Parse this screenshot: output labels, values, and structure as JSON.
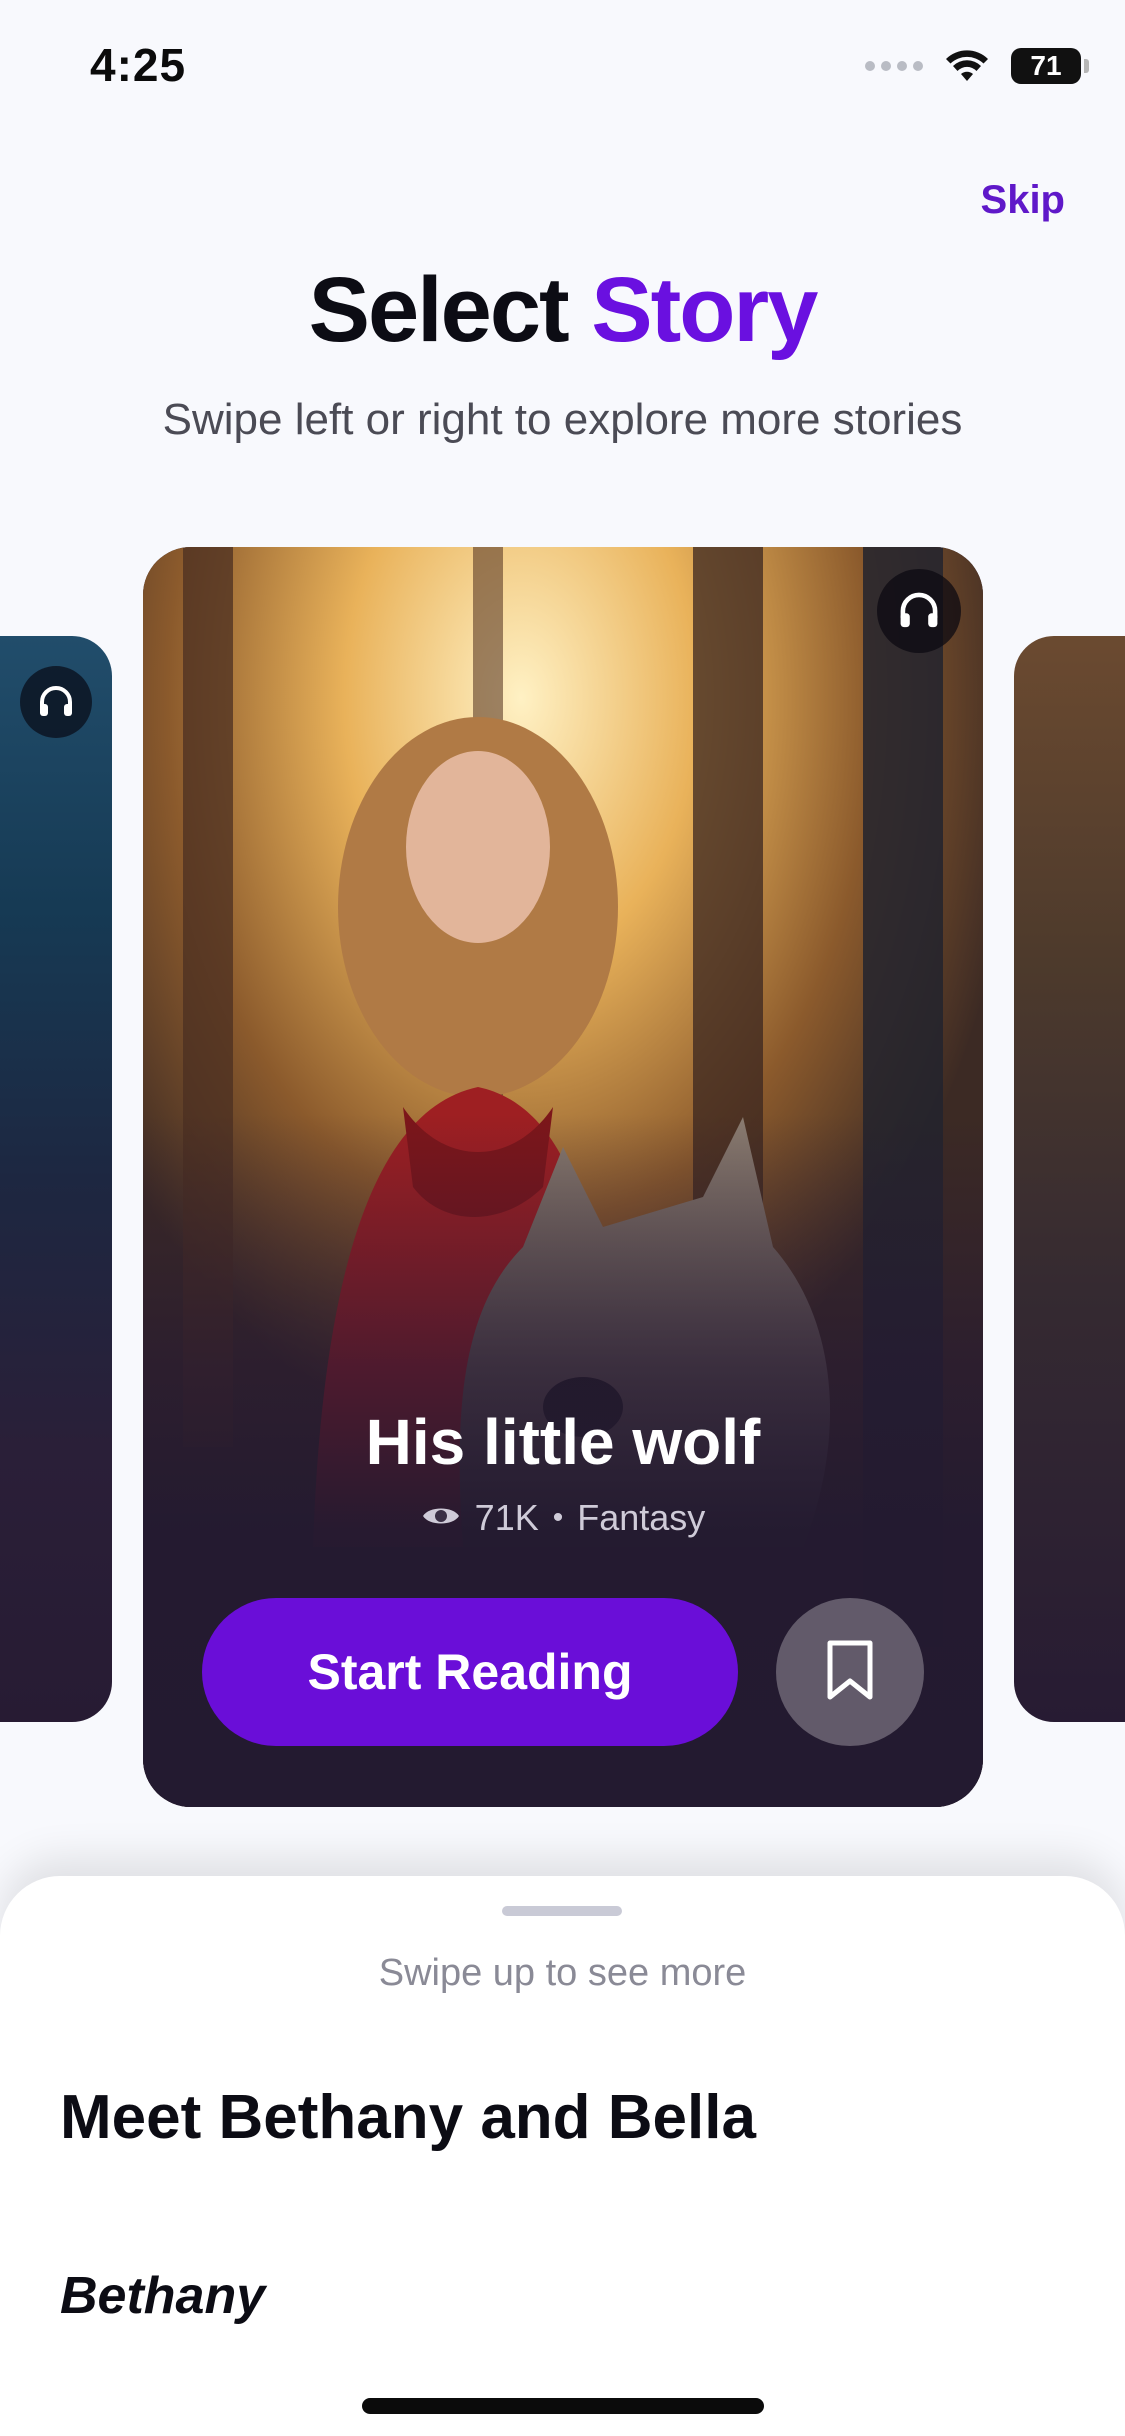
{
  "status_bar": {
    "time": "4:25",
    "battery": "71"
  },
  "header": {
    "skip_label": "Skip",
    "title_part1": "Select",
    "title_part2": "Story",
    "subtitle": "Swipe left or right to explore more stories"
  },
  "main_card": {
    "title": "His little wolf",
    "views": "71K",
    "separator": "•",
    "genre": "Fantasy",
    "start_label": "Start Reading"
  },
  "sheet": {
    "hint": "Swipe up to see more",
    "heading": "Meet Bethany and Bella",
    "subheading": "Bethany"
  },
  "colors": {
    "accent": "#6a0ed8",
    "title_accent": "#6a10e0",
    "card_bg": "#231a30"
  },
  "icons": [
    "headphones-icon",
    "eye-icon",
    "bookmark-icon",
    "wifi-icon"
  ]
}
